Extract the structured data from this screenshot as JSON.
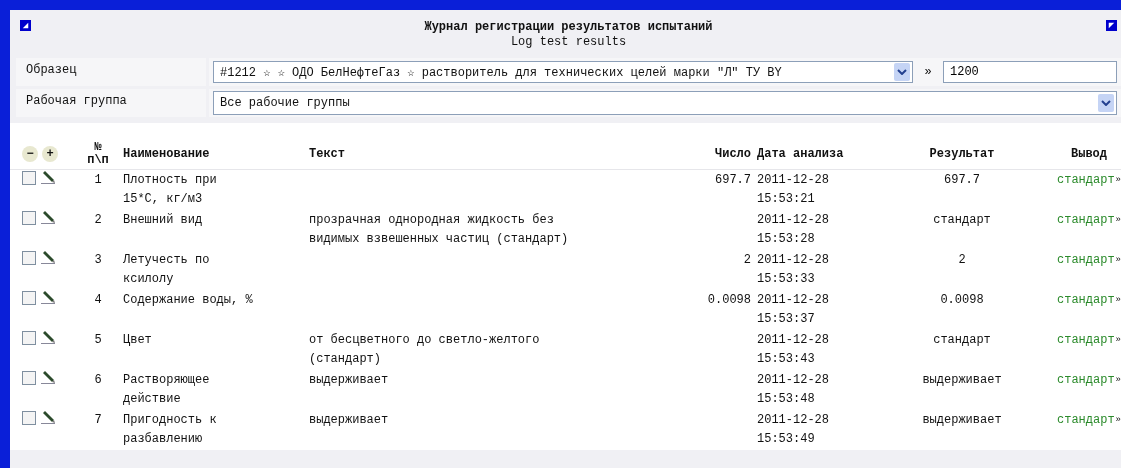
{
  "header": {
    "title": "Журнал регистрации результатов испытаний",
    "subtitle": "Log test results"
  },
  "filters": [
    {
      "kind": "sample",
      "label": "Образец",
      "value": "#1212 ☆ ☆ ОДО БелНефтеГаз ☆ растворитель для технических целей марки \"Л\" ТУ BY",
      "separator": "»",
      "extra": "1200"
    },
    {
      "kind": "group",
      "label": "Рабочая группа",
      "value": "Все рабочие группы"
    }
  ],
  "table": {
    "collapse": "−",
    "expand": "+",
    "columns": [
      "№\nп\\п",
      "Наименование",
      "Текст",
      "Число",
      "Дата анализа",
      "Результат",
      "Вывод"
    ],
    "rows": [
      {
        "checked": false,
        "n": "1",
        "name": "Плотность при 15*С, кг/м3",
        "text": "",
        "number": "697.7",
        "date": "2011-12-28 15:53:21",
        "result": "697.7",
        "conclusion": "стандарт",
        "more": "»"
      },
      {
        "checked": false,
        "n": "2",
        "name": "Внешний вид",
        "text": "прозрачная однородная жидкость без видимых взвешенных частиц (стандарт)",
        "number": "",
        "date": "2011-12-28 15:53:28",
        "result": "стандарт",
        "conclusion": "стандарт",
        "more": "»"
      },
      {
        "checked": false,
        "n": "3",
        "name": "Летучесть по ксилолу",
        "text": "",
        "number": "2",
        "date": "2011-12-28 15:53:33",
        "result": "2",
        "conclusion": "стандарт",
        "more": "»"
      },
      {
        "checked": false,
        "n": "4",
        "name": "Содержание воды, %",
        "text": "",
        "number": "0.0098",
        "date": "2011-12-28 15:53:37",
        "result": "0.0098",
        "conclusion": "стандарт",
        "more": "»"
      },
      {
        "checked": false,
        "n": "5",
        "name": "Цвет",
        "text": "от бесцветного до светло-желтого (стандарт)",
        "number": "",
        "date": "2011-12-28 15:53:43",
        "result": "стандарт",
        "conclusion": "стандарт",
        "more": "»"
      },
      {
        "checked": false,
        "n": "6",
        "name": "Растворяющее действие",
        "text": "выдерживает",
        "number": "",
        "date": "2011-12-28 15:53:48",
        "result": "выдерживает",
        "conclusion": "стандарт",
        "more": "»"
      },
      {
        "checked": false,
        "n": "7",
        "name": "Пригодность к разбавлению",
        "text": "выдерживает",
        "number": "",
        "date": "2011-12-28 15:53:49",
        "result": "выдерживает",
        "conclusion": "стандарт",
        "more": "»"
      }
    ]
  }
}
